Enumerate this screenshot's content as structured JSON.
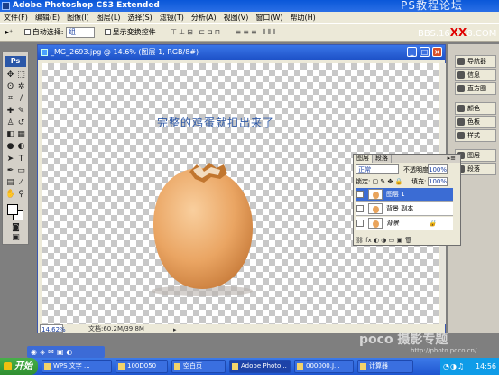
{
  "app": {
    "title": "Adobe Photoshop CS3 Extended",
    "watermark": "PS教程论坛",
    "watermark2_pre": "BBS.16",
    "watermark2_mark": "XX",
    "watermark2_post": "8.COM"
  },
  "menu": [
    "文件(F)",
    "编辑(E)",
    "图像(I)",
    "图层(L)",
    "选择(S)",
    "滤镜(T)",
    "分析(A)",
    "视图(V)",
    "窗口(W)",
    "帮助(H)"
  ],
  "options": {
    "auto_select": "自动选择:",
    "group": "组",
    "show_transform": "显示变换控件"
  },
  "toolbox": {
    "logo": "Ps"
  },
  "document": {
    "title": "_MG_2693.jpg @ 14.6% (图层 1, RGB/8#)",
    "headline": "完整的鸡蛋就扣出来了",
    "zoom": "14.62%",
    "doc_size": "文档:60.2M/39.8M"
  },
  "dock": [
    "导航器",
    "信息",
    "直方图",
    "颜色",
    "色板",
    "样式",
    "图层",
    "段落"
  ],
  "layers_panel": {
    "tabs": [
      "图层",
      "段落"
    ],
    "blend_mode": "正常",
    "opacity_label": "不透明度:",
    "opacity": "100%",
    "lock_label": "锁定:",
    "fill_label": "填充:",
    "fill": "100%",
    "layers": [
      {
        "name": "图层 1",
        "selected": true
      },
      {
        "name": "背景 副本",
        "selected": false
      },
      {
        "name": "背景",
        "selected": false,
        "locked": true
      }
    ],
    "bottom_icons": "⛓ fx ◐ ◑ ▭ ▣ 🗑"
  },
  "taskbar": {
    "start": "开始",
    "tasks": [
      "WPS 文字 ...",
      "100D050",
      "空白页",
      "Adobe Photo...",
      "000000.J...",
      "计算器"
    ],
    "tray": "14:56"
  },
  "watermark_poco": "poco 摄影专题",
  "watermark_url": "http://photo.poco.cn/"
}
